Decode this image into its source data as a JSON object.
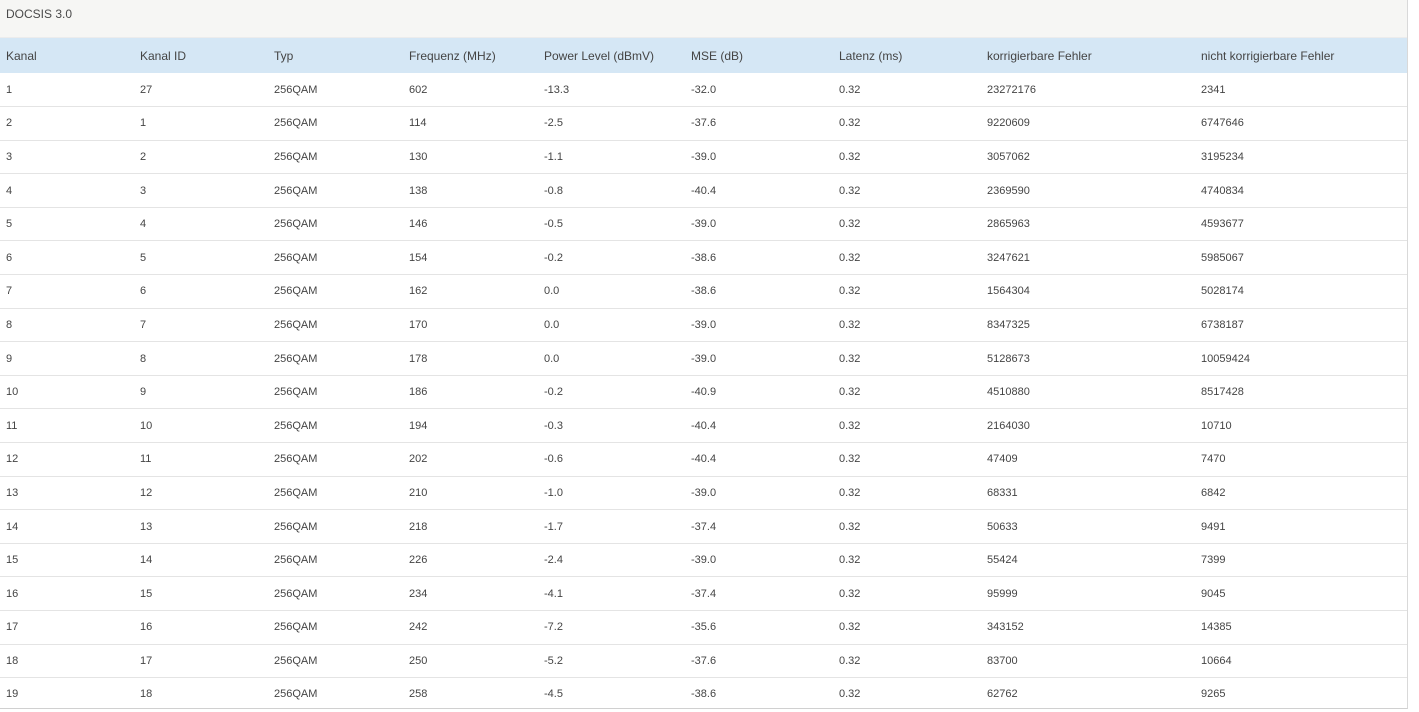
{
  "section": {
    "title": "DOCSIS 3.0"
  },
  "table": {
    "columns": [
      "Kanal",
      "Kanal ID",
      "Typ",
      "Frequenz (MHz)",
      "Power Level (dBmV)",
      "MSE (dB)",
      "Latenz (ms)",
      "korrigierbare Fehler",
      "nicht korrigierbare Fehler"
    ],
    "rows": [
      [
        "1",
        "27",
        "256QAM",
        "602",
        "-13.3",
        "-32.0",
        "0.32",
        "23272176",
        "2341"
      ],
      [
        "2",
        "1",
        "256QAM",
        "114",
        "-2.5",
        "-37.6",
        "0.32",
        "9220609",
        "6747646"
      ],
      [
        "3",
        "2",
        "256QAM",
        "130",
        "-1.1",
        "-39.0",
        "0.32",
        "3057062",
        "3195234"
      ],
      [
        "4",
        "3",
        "256QAM",
        "138",
        "-0.8",
        "-40.4",
        "0.32",
        "2369590",
        "4740834"
      ],
      [
        "5",
        "4",
        "256QAM",
        "146",
        "-0.5",
        "-39.0",
        "0.32",
        "2865963",
        "4593677"
      ],
      [
        "6",
        "5",
        "256QAM",
        "154",
        "-0.2",
        "-38.6",
        "0.32",
        "3247621",
        "5985067"
      ],
      [
        "7",
        "6",
        "256QAM",
        "162",
        "0.0",
        "-38.6",
        "0.32",
        "1564304",
        "5028174"
      ],
      [
        "8",
        "7",
        "256QAM",
        "170",
        "0.0",
        "-39.0",
        "0.32",
        "8347325",
        "6738187"
      ],
      [
        "9",
        "8",
        "256QAM",
        "178",
        "0.0",
        "-39.0",
        "0.32",
        "5128673",
        "10059424"
      ],
      [
        "10",
        "9",
        "256QAM",
        "186",
        "-0.2",
        "-40.9",
        "0.32",
        "4510880",
        "8517428"
      ],
      [
        "11",
        "10",
        "256QAM",
        "194",
        "-0.3",
        "-40.4",
        "0.32",
        "2164030",
        "10710"
      ],
      [
        "12",
        "11",
        "256QAM",
        "202",
        "-0.6",
        "-40.4",
        "0.32",
        "47409",
        "7470"
      ],
      [
        "13",
        "12",
        "256QAM",
        "210",
        "-1.0",
        "-39.0",
        "0.32",
        "68331",
        "6842"
      ],
      [
        "14",
        "13",
        "256QAM",
        "218",
        "-1.7",
        "-37.4",
        "0.32",
        "50633",
        "9491"
      ],
      [
        "15",
        "14",
        "256QAM",
        "226",
        "-2.4",
        "-39.0",
        "0.32",
        "55424",
        "7399"
      ],
      [
        "16",
        "15",
        "256QAM",
        "234",
        "-4.1",
        "-37.4",
        "0.32",
        "95999",
        "9045"
      ],
      [
        "17",
        "16",
        "256QAM",
        "242",
        "-7.2",
        "-35.6",
        "0.32",
        "343152",
        "14385"
      ],
      [
        "18",
        "17",
        "256QAM",
        "250",
        "-5.2",
        "-37.6",
        "0.32",
        "83700",
        "10664"
      ],
      [
        "19",
        "18",
        "256QAM",
        "258",
        "-4.5",
        "-38.6",
        "0.32",
        "62762",
        "9265"
      ]
    ]
  },
  "colors": {
    "header_row_bg": "#d5e7f5",
    "panel_header_bg": "#f6f6f4",
    "row_divider": "#e4e4e4"
  }
}
